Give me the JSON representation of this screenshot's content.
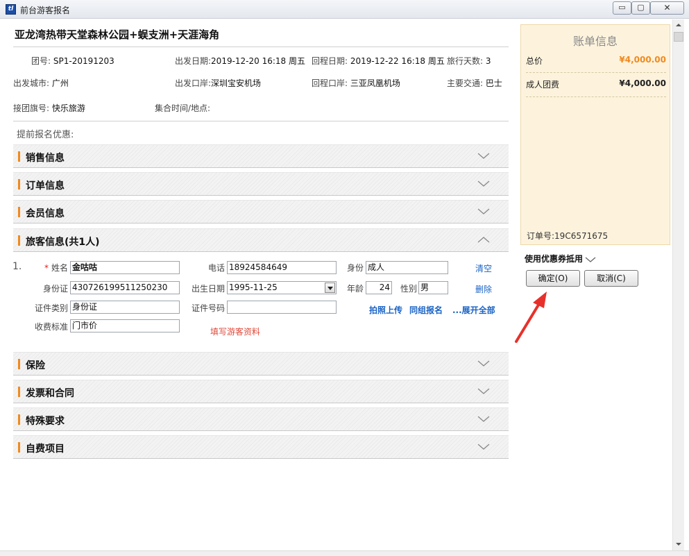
{
  "window": {
    "title": "前台游客报名",
    "app_icon": "tl",
    "minimize": "▭",
    "maximize": "▢",
    "close": "✕"
  },
  "tour": {
    "title": "亚龙湾热带天堂森林公园+蜈支洲+天涯海角",
    "group_no_label": "团号:",
    "group_no": "SP1-20191203",
    "depart_date_label": "出发日期:",
    "depart_date": "2019-12-20 16:18 周五",
    "return_date_label": "回程日期:",
    "return_date": "2019-12-22 16:18 周五",
    "days_label": "旅行天数:",
    "days": "3",
    "depart_city_label": "出发城市:",
    "depart_city": "广州",
    "depart_port_label": "出发口岸:",
    "depart_port": "深圳宝安机场",
    "return_port_label": "回程口岸:",
    "return_port": "三亚凤凰机场",
    "transport_label": "主要交通:",
    "transport": "巴士",
    "flag_label": "接团旗号:",
    "flag": "快乐旅游",
    "meeting_label": "集合时间/地点:",
    "meeting": "",
    "promo_label": "提前报名优惠:"
  },
  "sections": {
    "sales": "销售信息",
    "order": "订单信息",
    "member": "会员信息",
    "travelers": "旅客信息(共1人)",
    "insurance": "保险",
    "invoice": "发票和合同",
    "special": "特殊要求",
    "extra": "自费项目"
  },
  "traveler": {
    "index": "1.",
    "required_mark": "*",
    "name_label": "姓名",
    "name": "金咕咕",
    "phone_label": "电话",
    "phone": "18924584649",
    "identity_label": "身份",
    "identity": "成人",
    "idcard_label": "身份证",
    "idcard": "430726199511250230",
    "birth_label": "出生日期",
    "birth": "1995-11-25",
    "age_label": "年龄",
    "age": "24",
    "gender_label": "性别",
    "gender": "男",
    "cert_type_label": "证件类别",
    "cert_type": "身份证",
    "cert_no_label": "证件号码",
    "cert_no": "",
    "fee_label": "收费标准",
    "fee": "门市价",
    "clear": "清空",
    "delete": "删除",
    "photo_upload": "拍照上传",
    "same_group": "同组报名",
    "expand_all": "...展开全部",
    "fill_info": "填写游客资料"
  },
  "bill": {
    "title": "账单信息",
    "total_label": "总价",
    "total": "¥4,000.00",
    "adult_label": "成人团费",
    "adult": "¥4,000.00",
    "order_no": "订单号:19C6571675",
    "total_color": "#f08a1e",
    "adult_color": "#222222"
  },
  "actions": {
    "coupon": "使用优惠券抵用",
    "ok": "确定(O)",
    "cancel": "取消(C)"
  }
}
